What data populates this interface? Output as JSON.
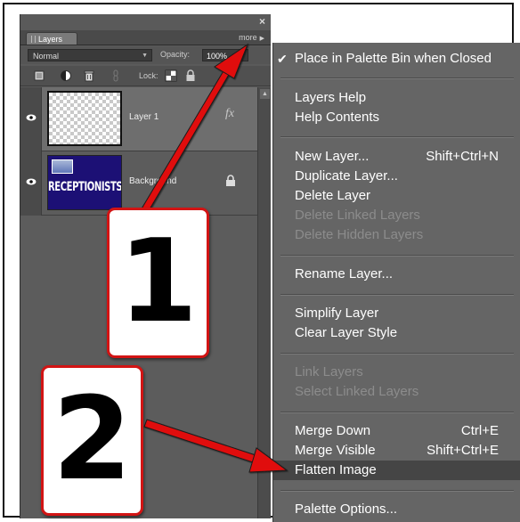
{
  "palette": {
    "close_glyph": "×",
    "tab_label": "Layers",
    "more_label": "more",
    "blend_mode": "Normal",
    "opacity_label": "Opacity:",
    "opacity_value": "100%",
    "lock_label": "Lock:",
    "tool_icons": [
      "new-layer-icon",
      "adjustment-layer-icon",
      "trash-icon",
      "link-icon",
      "lock-transparent-icon",
      "lock-all-icon"
    ],
    "layers": [
      {
        "name": "Layer 1",
        "thumbnail": "transparent-checkerboard",
        "visible": true,
        "selected": true,
        "badge": "fx"
      },
      {
        "name": "Background",
        "thumbnail": "receptionists-image",
        "thumbnail_text": "RECEPTIONISTS",
        "visible": true,
        "selected": false,
        "locked": true
      }
    ]
  },
  "menu": {
    "items": [
      {
        "label": "Place in Palette Bin when Closed",
        "checked": true
      },
      {
        "label": "Layers Help"
      },
      {
        "label": "Help Contents"
      },
      {
        "label": "New Layer...",
        "shortcut": "Shift+Ctrl+N"
      },
      {
        "label": "Duplicate Layer..."
      },
      {
        "label": "Delete Layer"
      },
      {
        "label": "Delete Linked Layers",
        "disabled": true
      },
      {
        "label": "Delete Hidden Layers",
        "disabled": true
      },
      {
        "label": "Rename Layer..."
      },
      {
        "label": "Simplify Layer"
      },
      {
        "label": "Clear Layer Style"
      },
      {
        "label": "Link Layers",
        "disabled": true
      },
      {
        "label": "Select Linked Layers",
        "disabled": true
      },
      {
        "label": "Merge Down",
        "shortcut": "Ctrl+E"
      },
      {
        "label": "Merge Visible",
        "shortcut": "Shift+Ctrl+E"
      },
      {
        "label": "Flatten Image",
        "highlighted": true
      },
      {
        "label": "Palette Options..."
      }
    ]
  },
  "callouts": [
    {
      "label": "1"
    },
    {
      "label": "2"
    }
  ],
  "colors": {
    "callout_border": "#d21414",
    "arrow": "#e01010",
    "menu_bg": "#656565",
    "panel_bg": "#5a5a5a"
  }
}
